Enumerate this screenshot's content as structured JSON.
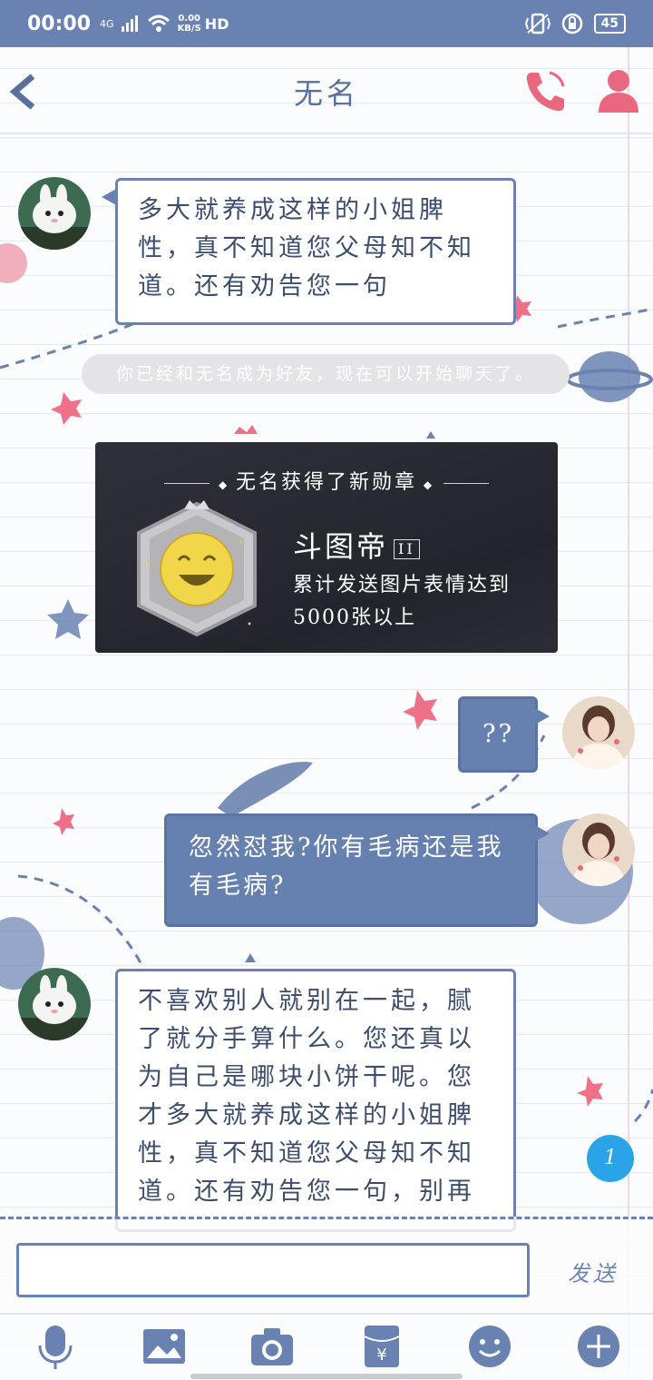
{
  "status_bar": {
    "time": "00:00",
    "signal_label": "4G",
    "net_speed_value": "0.00",
    "net_speed_unit": "KB/S",
    "hd_label": "HD",
    "battery": "45"
  },
  "header": {
    "title": "无名"
  },
  "messages": {
    "incoming_1": "多大就养成这样的小姐脾性，真不知道您父母知不知道。还有劝告您一句",
    "system_notice": "你已经和无名成为好友，现在可以开始聊天了。",
    "badge_card": {
      "heading": "无名获得了新勋章",
      "badge_name": "斗图帝",
      "badge_level": "II",
      "badge_desc": "累计发送图片表情达到5000张以上"
    },
    "outgoing_1": "??",
    "outgoing_2": "忽然怼我?你有毛病还是我有毛病?",
    "incoming_2": "不喜欢别人就别在一起，腻了就分手算什么。您还真以为自己是哪块小饼干呢。您才多大就养成这样的小姐脾性，真不知道您父母知不知道。还有劝告您一句，别再"
  },
  "unread_count": "1",
  "input": {
    "value": "",
    "send_label": "发送"
  },
  "colors": {
    "accent": "#6a82b2",
    "pink": "#e9687f",
    "unread": "#2aa4e6"
  },
  "toolbar_icons": [
    "microphone-icon",
    "image-icon",
    "camera-icon",
    "red-packet-icon",
    "emoji-icon",
    "plus-icon"
  ]
}
